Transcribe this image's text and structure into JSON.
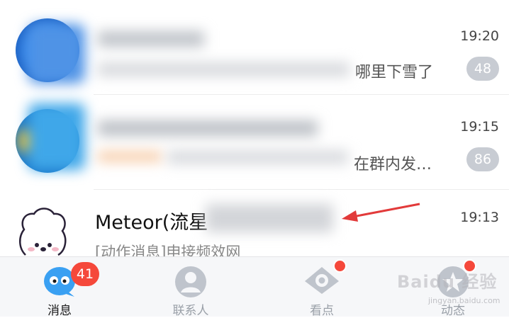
{
  "conversations": [
    {
      "time": "19:20",
      "preview_tail": "哪里下雪了",
      "unread": "48"
    },
    {
      "time": "19:15",
      "preview_tail": "在群内发…",
      "unread": "86"
    },
    {
      "time": "19:13",
      "name": "Meteor(流星",
      "preview": "[动作消息]申接频效网"
    }
  ],
  "tabbar": {
    "tabs": [
      {
        "label": "消息",
        "badge": "41",
        "active": true
      },
      {
        "label": "联系人"
      },
      {
        "label": "看点",
        "dot": true
      },
      {
        "label": "动态",
        "dot": true
      }
    ]
  },
  "watermark": {
    "text": "Baidu 经验",
    "sub": "jingyan.baidu.com"
  },
  "colors": {
    "accent": "#f5483b",
    "badge_gray": "#c8ccd3",
    "brand_blue": "#3aa0f2"
  }
}
